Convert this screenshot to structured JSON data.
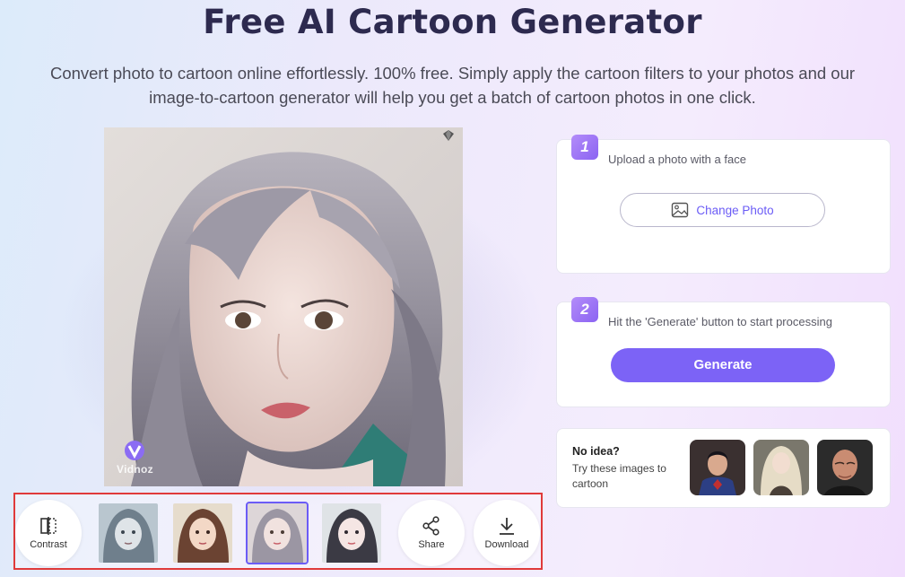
{
  "header": {
    "title": "Free AI Cartoon Generator",
    "subtitle_line1": "Convert photo to cartoon online effortlessly. 100% free. Simply apply the cartoon filters to your photos and our",
    "subtitle_line2": "image-to-cartoon generator will help you get a batch of cartoon photos in one click."
  },
  "preview": {
    "watermark": "Vidnoz"
  },
  "toolbar": {
    "contrast_label": "Contrast",
    "share_label": "Share",
    "download_label": "Download",
    "selected_style_index": 3
  },
  "step1": {
    "number": "1",
    "text": "Upload a photo with a face",
    "button_label": "Change Photo"
  },
  "step2": {
    "number": "2",
    "text": "Hit the 'Generate' button to start processing",
    "button_label": "Generate"
  },
  "samples": {
    "title": "No idea?",
    "text": "Try these images to cartoon"
  },
  "colors": {
    "accent": "#7c63f6",
    "highlight_border": "#e03a3a",
    "title": "#2d2a4f"
  }
}
